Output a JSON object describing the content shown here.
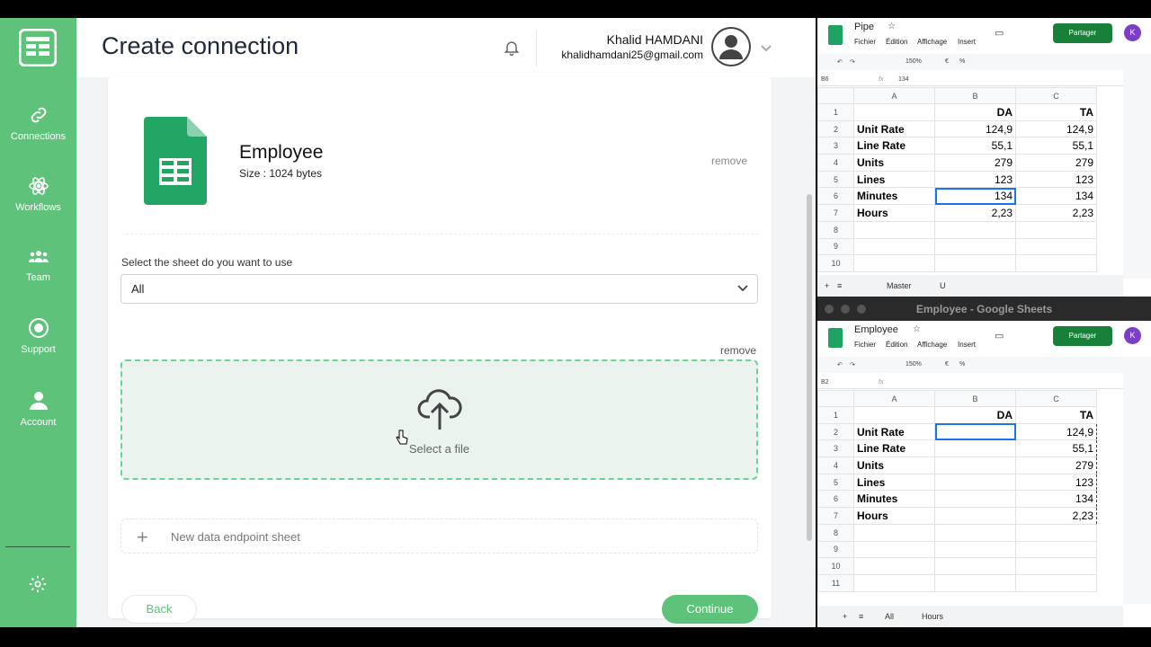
{
  "sidebar": {
    "items": [
      {
        "label": "Connections",
        "icon": "link-icon"
      },
      {
        "label": "Workflows",
        "icon": "atom-icon"
      },
      {
        "label": "Team",
        "icon": "team-icon"
      },
      {
        "label": "Support",
        "icon": "support-icon"
      },
      {
        "label": "Account",
        "icon": "user-icon"
      }
    ]
  },
  "header": {
    "title": "Create connection",
    "user_name": "Khalid HAMDANI",
    "user_email": "khalidhamdani25@gmail.com"
  },
  "file": {
    "name": "Employee",
    "size": "Size : 1024 bytes",
    "remove": "remove"
  },
  "sheet": {
    "label": "Select the sheet do you want to use",
    "selected": "All"
  },
  "dropzone": {
    "remove": "remove",
    "text": "Select a file"
  },
  "new_endpoint": "New data endpoint sheet",
  "buttons": {
    "back": "Back",
    "continue": "Continue"
  },
  "colors": {
    "brand": "#5ec27a",
    "sheets_green": "#188038"
  },
  "sheets1": {
    "title": "Pipe",
    "menu": [
      "Fichier",
      "Édition",
      "Affichage",
      "Insert"
    ],
    "share": "Partager",
    "avatar": "K",
    "cell_ref": "B6",
    "cell_value": "134",
    "zoom": "150%",
    "tabs": [
      "Master",
      "U"
    ],
    "columns": [
      "A",
      "B",
      "C"
    ],
    "header_row": [
      "",
      "DA",
      "TA"
    ],
    "rows": [
      [
        "Unit Rate",
        "124,9",
        "124,9"
      ],
      [
        "Line Rate",
        "55,1",
        "55,1"
      ],
      [
        "Units",
        "279",
        "279"
      ],
      [
        "Lines",
        "123",
        "123"
      ],
      [
        "Minutes",
        "134",
        "134"
      ],
      [
        "Hours",
        "2,23",
        "2,23"
      ]
    ]
  },
  "sheets2": {
    "window_title": "Employee - Google Sheets",
    "title": "Employee",
    "menu": [
      "Fichier",
      "Édition",
      "Affichage",
      "Insert"
    ],
    "share": "Partager",
    "avatar": "K",
    "cell_ref": "B2",
    "zoom": "150%",
    "tabs": [
      "All",
      "Hours"
    ],
    "columns": [
      "A",
      "B",
      "C"
    ],
    "header_row": [
      "",
      "DA",
      "TA"
    ],
    "rows": [
      [
        "Unit Rate",
        "",
        "124,9"
      ],
      [
        "Line Rate",
        "",
        "55,1"
      ],
      [
        "Units",
        "",
        "279"
      ],
      [
        "Lines",
        "",
        "123"
      ],
      [
        "Minutes",
        "",
        "134"
      ],
      [
        "Hours",
        "",
        "2,23"
      ]
    ]
  }
}
